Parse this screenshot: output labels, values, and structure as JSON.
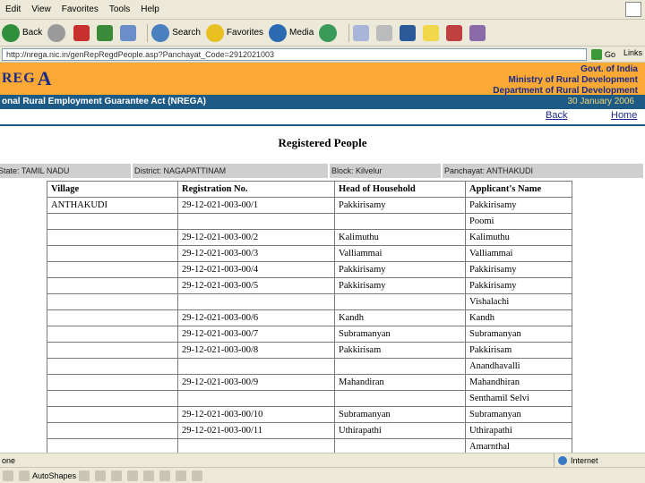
{
  "menu": {
    "items": [
      "Edit",
      "View",
      "Favorites",
      "Tools",
      "Help"
    ]
  },
  "toolbar": {
    "back": "Back",
    "search": "Search",
    "favorites": "Favorites",
    "media": "Media"
  },
  "address": {
    "url": "http://nrega.nic.in/genRepRegdPeople.asp?Panchayat_Code=2912021003",
    "go": "Go",
    "links": "Links"
  },
  "header": {
    "logo_small": "REG",
    "logo_big": "A",
    "gov_lines": [
      "Govt. of India",
      "Ministry of Rural Development",
      "Department of Rural Development"
    ],
    "act_title": "onal Rural Employment Guarantee Act (NREGA)",
    "date": "30 January 2006"
  },
  "nav": {
    "back": "Back",
    "home": "Home"
  },
  "page_title": "Registered People",
  "filters": {
    "state": "State: TAMIL NADU",
    "district": "District: NAGAPATTINAM",
    "block": "Block: Kilvelur",
    "panchayat": "Panchayat: ANTHAKUDI"
  },
  "table": {
    "headers": [
      "Village",
      "Registration No.",
      "Head of Household",
      "Applicant's Name"
    ],
    "rows": [
      [
        "ANTHAKUDI",
        "29-12-021-003-00/1",
        "Pakkirisamy",
        "Pakkirisamy"
      ],
      [
        "",
        "",
        "",
        "Poomi"
      ],
      [
        "",
        "29-12-021-003-00/2",
        "Kalimuthu",
        "Kalimuthu"
      ],
      [
        "",
        "29-12-021-003-00/3",
        "Valliammai",
        "Valliammai"
      ],
      [
        "",
        "29-12-021-003-00/4",
        "Pakkirisamy",
        "Pakkirisamy"
      ],
      [
        "",
        "29-12-021-003-00/5",
        "Pakkirisamy",
        "Pakkirisamy"
      ],
      [
        "",
        "",
        "",
        "Vishalachi"
      ],
      [
        "",
        "29-12-021-003-00/6",
        "Kandh",
        "Kandh"
      ],
      [
        "",
        "29-12-021-003-00/7",
        "Subramanyan",
        "Subramanyan"
      ],
      [
        "",
        "29-12-021-003-00/8",
        "Pakkirisam",
        "Pakkirisam"
      ],
      [
        "",
        "",
        "",
        "Anandhavalli"
      ],
      [
        "",
        "29-12-021-003-00/9",
        "Mahandiran",
        "Mahandhiran"
      ],
      [
        "",
        "",
        "",
        "Senthamil Selvi"
      ],
      [
        "",
        "29-12-021-003-00/10",
        "Subramanyan",
        "Subramanyan"
      ],
      [
        "",
        "29-12-021-003-00/11",
        "Uthirapathi",
        "Uthirapathi"
      ],
      [
        "",
        "",
        "",
        "Amarnthal"
      ]
    ]
  },
  "status": {
    "left": "one",
    "zone": "Internet"
  },
  "drawbar": {
    "autoshapes": "AutoShapes"
  },
  "colors": {
    "header_orange": "#f9a934",
    "title_blue": "#1d5a86",
    "logo_navy": "#1b2a86",
    "filter_gray": "#cfcfcf"
  }
}
